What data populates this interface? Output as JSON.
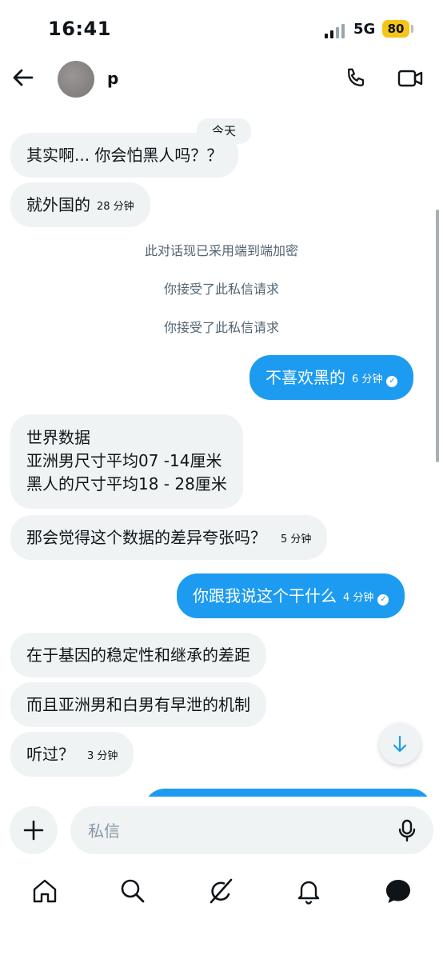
{
  "status": {
    "time": "16:41",
    "network": "5G",
    "battery": "80"
  },
  "header": {
    "contact_name": "p"
  },
  "messages": {
    "date_label": "今天",
    "m1": {
      "text": "其实啊... 你会怕黑人吗？？"
    },
    "m2": {
      "text": "就外国的",
      "time": "28 分钟"
    },
    "system1": "此对话现已采用端到端加密",
    "system2": "你接受了此私信请求",
    "system3": "你接受了此私信请求",
    "m3": {
      "text": "不喜欢黑的",
      "time": "6 分钟"
    },
    "m4": {
      "line1": "世界数据",
      "line2": "亚洲男尺寸平均07 -14厘米",
      "line3": "黑人的尺寸平均18 - 28厘米"
    },
    "m5": {
      "text": "那会觉得这个数据的差异夸张吗？",
      "time": "5 分钟"
    },
    "m6": {
      "text": "你跟我说这个干什么",
      "time": "4 分钟"
    },
    "m7": {
      "text": "在于基因的稳定性和继承的差距"
    },
    "m8": {
      "text": "而且亚洲男和白男有早泄的机制"
    },
    "m9": {
      "text": "听过？",
      "time": "3 分钟"
    }
  },
  "composer": {
    "placeholder": "私信"
  },
  "icons": {
    "back": "arrow-left-icon",
    "call": "phone-icon",
    "video": "video-camera-icon",
    "scroll": "arrow-down-icon",
    "add": "plus-icon",
    "mic": "microphone-icon",
    "home": "home-icon",
    "search": "search-icon",
    "grok": "grok-icon",
    "notifications": "bell-icon",
    "messages": "message-icon"
  },
  "colors": {
    "accent": "#1d9bf0",
    "incoming_bubble": "#eff3f4",
    "battery": "#f5c518"
  }
}
